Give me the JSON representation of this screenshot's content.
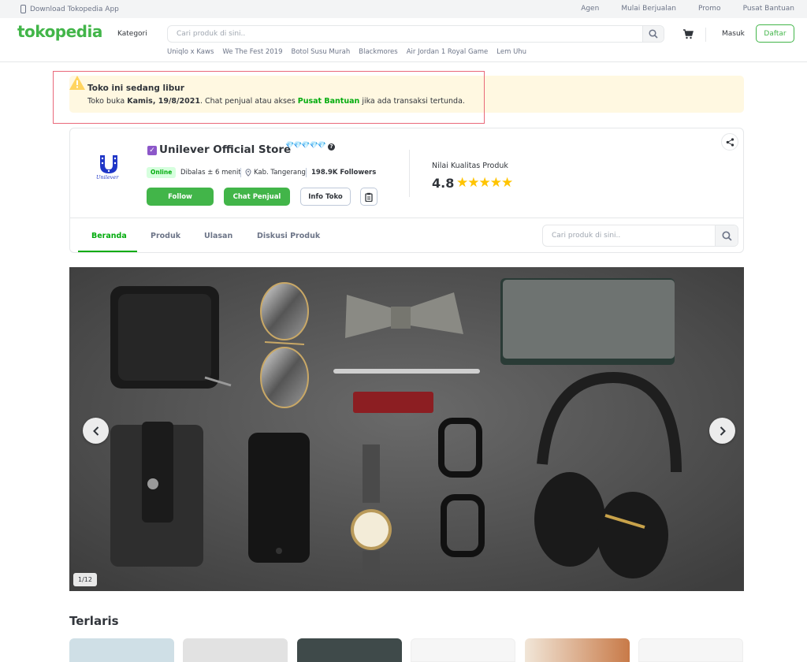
{
  "topbar": {
    "download": "Download Tokopedia App",
    "links": [
      "Agen",
      "Mulai Berjualan",
      "Promo",
      "Pusat Bantuan"
    ]
  },
  "header": {
    "logo": "tokopedia",
    "kategori": "Kategori",
    "search_placeholder": "Cari produk di sini..",
    "masuk": "Masuk",
    "daftar": "Daftar",
    "trending": [
      "Uniqlo x Kaws",
      "We The Fest 2019",
      "Botol Susu Murah",
      "Blackmores",
      "Air Jordan 1 Royal Game",
      "Lem Uhu"
    ]
  },
  "notice": {
    "title": "Toko ini sedang libur",
    "text_before": "Toko buka ",
    "date": "Kamis, 19/8/2021",
    "text_middle": ". Chat penjual atau akses ",
    "link": "Pusat Bantuan",
    "text_after": " jika ada transaksi tertunda."
  },
  "shop": {
    "logo_text": "Unilever",
    "name": "Unilever Official Store",
    "status": "Online",
    "reply_time": "Dibalas ± 6 menit",
    "location": "Kab. Tangerang",
    "followers": "198.9K Followers",
    "follow": "Follow",
    "chat": "Chat Penjual",
    "info": "Info Toko",
    "rating_label": "Nilai Kualitas Produk",
    "rating": "4.8",
    "stars": "★★★★★"
  },
  "tabs": [
    "Beranda",
    "Produk",
    "Ulasan",
    "Diskusi Produk"
  ],
  "shop_search_placeholder": "Cari produk di sini..",
  "banner": {
    "counter": "1/12"
  },
  "section_title": "Terlaris",
  "colors": {
    "brand": "#42b549",
    "accent_link": "#03ac0e",
    "star": "#ffc400",
    "notice_bg": "#fff8e1"
  }
}
